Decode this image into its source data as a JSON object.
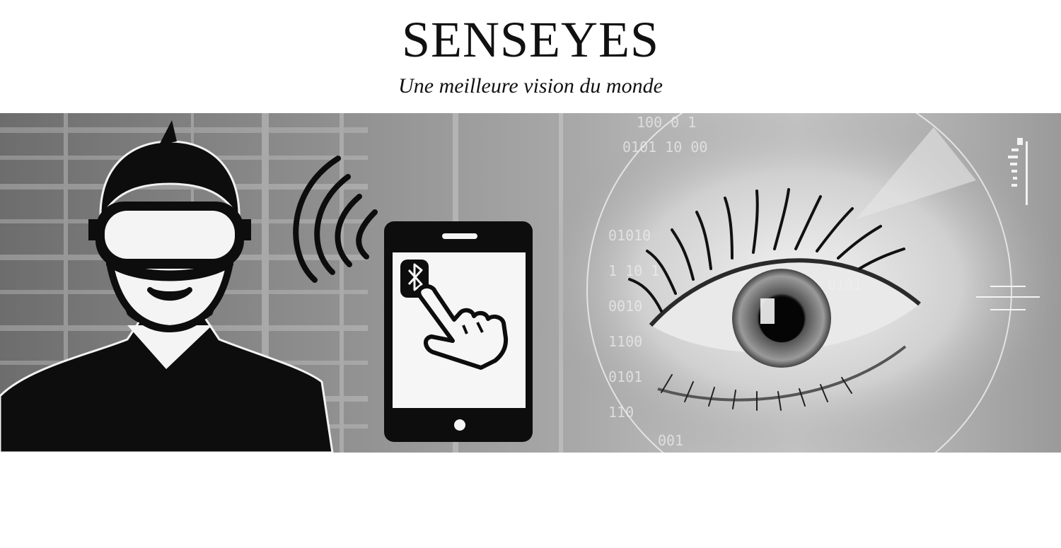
{
  "header": {
    "title": "SENSEYES",
    "tagline": "Une meilleure vision du monde"
  },
  "banner": {
    "illustrations": [
      "person-vr-headset-icon",
      "wireless-signal-icon",
      "smartphone-icon",
      "bluetooth-icon",
      "pointing-hand-icon",
      "eye-photo"
    ],
    "binary_digits": [
      "100 0 1",
      "0101 10 00",
      "01010",
      "1 10 1",
      "0010",
      "1100",
      "0101",
      "110",
      "001",
      "0101"
    ],
    "palette": {
      "dark": "#111111",
      "light": "#f4f4f4",
      "bg_mid": "#8a8a8a"
    }
  }
}
